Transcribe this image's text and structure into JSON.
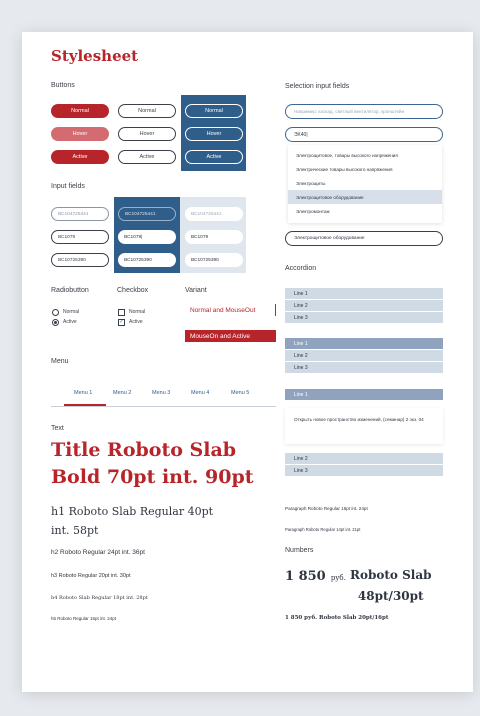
{
  "page_title": "Stylesheet",
  "sections": {
    "buttons": "Buttons",
    "input_fields": "Input fields",
    "radiobutton": "Radiobutton",
    "checkbox": "Checkbox",
    "variant": "Variant",
    "menu": "Menu",
    "text": "Text",
    "selection_input_fields": "Selection input fields",
    "accordion": "Accordion",
    "numbers": "Numbers"
  },
  "buttons": {
    "normal": "Normal",
    "hover": "Hover",
    "active": "Active"
  },
  "inputs": {
    "row1": "ВС104725441",
    "row2_plain": "ВС1079",
    "row2_filled": "ВС1079|",
    "row2_gray": "ВС1079",
    "row3": "ВС10725390"
  },
  "radio": {
    "normal": "Normal",
    "active": "Active"
  },
  "checkbox": {
    "normal": "Normal",
    "active": "Active"
  },
  "variant": {
    "normal": "Normal and MouseOut",
    "active": "MouseOn and Active"
  },
  "menu": {
    "items": [
      "Menu 1",
      "Menu 2",
      "Menu 3",
      "Menu 4",
      "Menu 5"
    ],
    "active_index": 0
  },
  "text_samples": {
    "title_line1": "Title Roboto Slab",
    "title_line2": "Bold 70pt int. 90pt",
    "h1_line1": "h1 Roboto Slab Regular 40pt",
    "h1_line2": "int. 58pt",
    "h2": "h2 Roboto Regular 24pt  int. 36pt",
    "h3": "h3 Roboto Regular 20pt int. 30pt",
    "h4": "h4 Roboto Slab Regular 18pt int. 28pt",
    "h5": "h5 Roboto Regular 16pt int. 24pt",
    "p1": "Paragraph Roboto Regular 16pt int. 24pt",
    "p2": "Paragraph Roboto Regular 14pt int. 21pt"
  },
  "selection": {
    "placeholder": "Например: каскад, светлый вентилятор, кронштейн",
    "query": "ЭХ40|",
    "options": [
      "Электрощитовое, товары высокого напряжения",
      "Электрические товары высокого напряжения",
      "Электрощиты",
      "Электрощитовое оборудование",
      "Электромонтаж"
    ],
    "highlighted_index": 3,
    "selected_value": "Электрощитовое оборудование"
  },
  "accordion": {
    "group1": [
      "Line 1",
      "Line 2",
      "Line 3"
    ],
    "group2": [
      "Line 1",
      "Line 2",
      "Line 3"
    ],
    "group3_header": "Line 1",
    "group3_body": "Открыть новое пространство изменений, (семинар) 2 экз. 04",
    "group4": [
      "Line 2",
      "Line 3"
    ]
  },
  "numbers": {
    "big_value": "1 850",
    "big_unit": "руб.",
    "big_caption_line1": "Roboto Slab",
    "big_caption_line2": "48pt/30pt",
    "small_value": "1 850 руб.",
    "small_caption": "Roboto Slab 20pt/16pt"
  },
  "colors": {
    "brand_red": "#b7252b",
    "brand_blue": "#2f5e8b",
    "accordion_dark": "#8fa3bf",
    "accordion_light": "#d0dae5"
  }
}
